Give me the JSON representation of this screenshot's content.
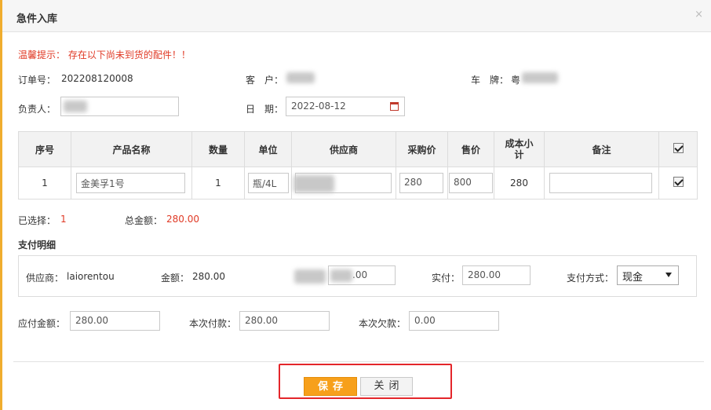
{
  "dialog": {
    "title": "急件入库",
    "close_glyph": "×"
  },
  "notice": "温馨提示： 存在以下尚未到货的配件！！",
  "order": {
    "order_no_label": "订单号：",
    "order_no": "202208120008",
    "customer_label": "客　户：",
    "plate_label": "车　牌：",
    "plate_prefix": "粤",
    "owner_label": "负责人：",
    "date_label": "日　期：",
    "date_value": "2022-08-12"
  },
  "table": {
    "headers": [
      "序号",
      "产品名称",
      "数量",
      "单位",
      "供应商",
      "采购价",
      "售价",
      "成本小计",
      "备注"
    ],
    "rows": [
      {
        "index": "1",
        "product": "金美孚1号",
        "qty": "1",
        "unit": "瓶/4L",
        "supplier": "",
        "purchase_price": "280",
        "sale_price": "800",
        "cost_subtotal": "280",
        "remark": ""
      }
    ]
  },
  "summary": {
    "selected_label": "已选择：",
    "selected_count": "1",
    "total_label": "总金额：",
    "total_value": "280.00"
  },
  "payment": {
    "section_title": "支付明细",
    "supplier_label": "供应商：",
    "supplier_value": "laiorentou",
    "amount_label": "金额：",
    "amount_value": "280.00",
    "hidden_field_value": ".00",
    "paid_label": "实付：",
    "paid_value": "280.00",
    "method_label": "支付方式：",
    "method_value": "现金"
  },
  "totals": {
    "payable_label": "应付金额：",
    "payable_value": "280.00",
    "this_pay_label": "本次付款：",
    "this_pay_value": "280.00",
    "owed_label": "本次欠款：",
    "owed_value": "0.00"
  },
  "buttons": {
    "save": "保存",
    "close": "关闭"
  },
  "colors": {
    "accent": "#f7a01b",
    "warning": "#e03a26",
    "highlight_border": "#e4262b"
  }
}
